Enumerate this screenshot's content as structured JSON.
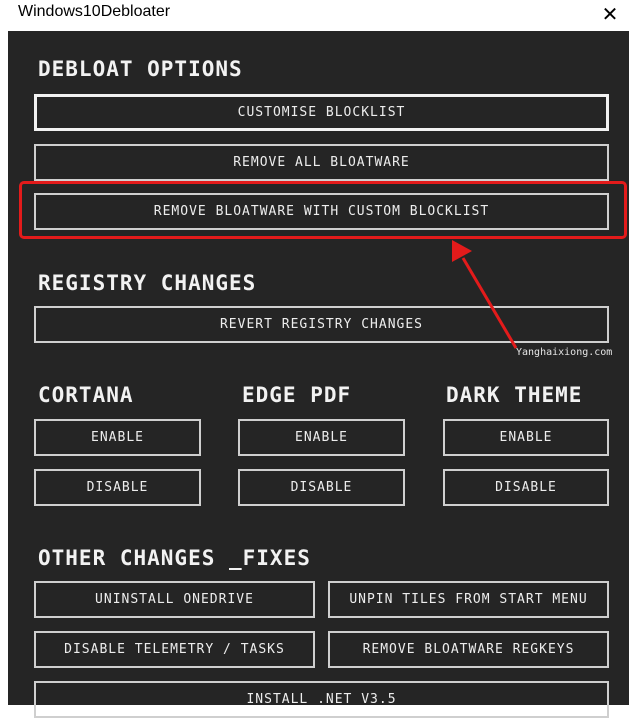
{
  "window": {
    "title": "Windows10Debloater",
    "close_glyph": "✕"
  },
  "sections": {
    "debloat": "DEBLOAT OPTIONS",
    "registry": "REGISTRY CHANGES",
    "cortana": "CORTANA",
    "edge_pdf": "EDGE PDF",
    "dark_theme": "DARK THEME",
    "other": "OTHER CHANGES _FIXES"
  },
  "buttons": {
    "customise_blocklist": "CUSTOMISE BLOCKLIST",
    "remove_all_bloatware": "REMOVE ALL BLOATWARE",
    "remove_custom_blocklist": "REMOVE BLOATWARE WITH CUSTOM BLOCKLIST",
    "revert_registry": "REVERT REGISTRY CHANGES",
    "cortana_enable": "ENABLE",
    "cortana_disable": "DISABLE",
    "edge_enable": "ENABLE",
    "edge_disable": "DISABLE",
    "dark_enable": "ENABLE",
    "dark_disable": "DISABLE",
    "uninstall_onedrive": "UNINSTALL ONEDRIVE",
    "unpin_tiles": "UNPIN TILES FROM START MENU",
    "disable_telemetry": "DISABLE TELEMETRY / TASKS",
    "remove_regkeys": "REMOVE BLOATWARE REGKEYS",
    "install_net": "INSTALL .NET V3.5"
  },
  "annotation": {
    "watermark": "Yanghaixiong.com",
    "highlight_color": "#e31b1b"
  },
  "colors": {
    "background": "#252525",
    "border": "#cfcfcf",
    "text": "#ededed"
  }
}
